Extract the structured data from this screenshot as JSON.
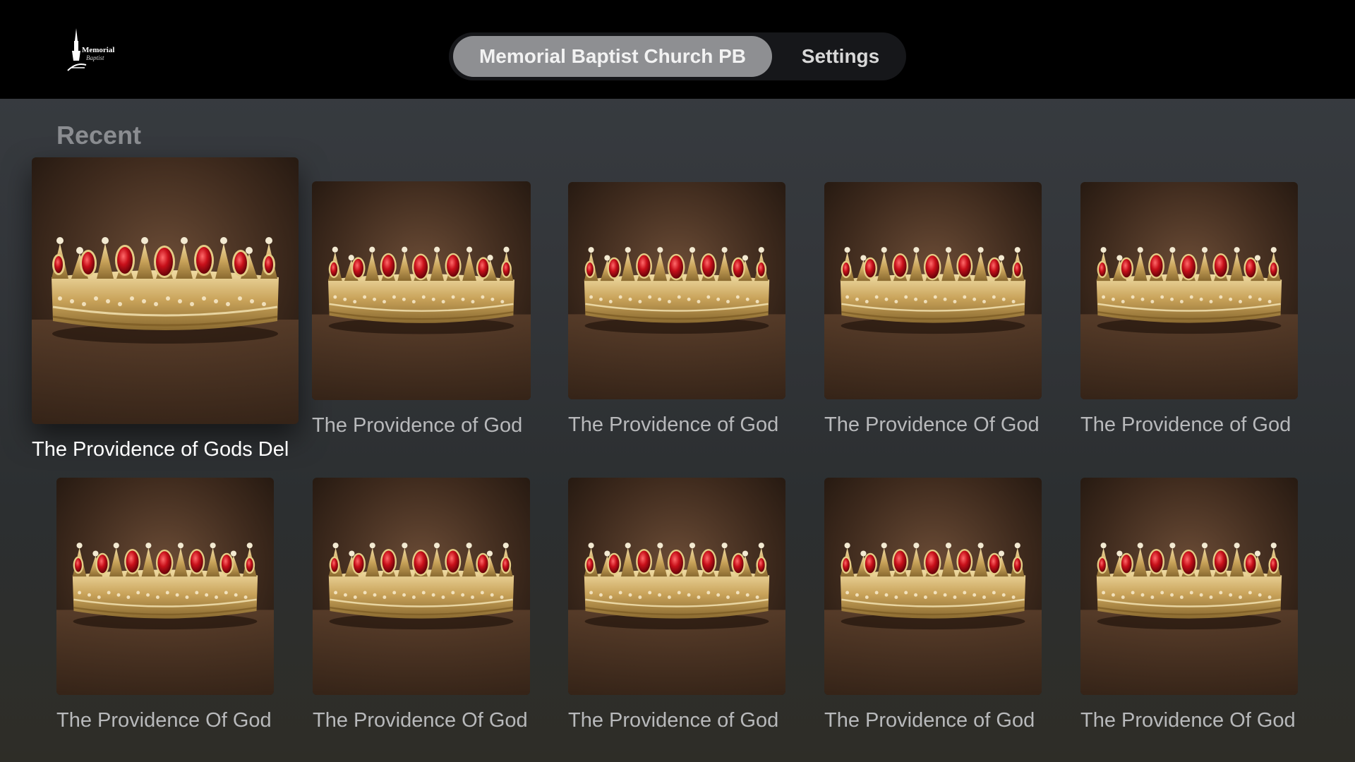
{
  "app": {
    "logo_text": "Memorial",
    "logo_sub": "Baptist"
  },
  "nav": {
    "tabs": [
      {
        "label": "Memorial Baptist Church PB",
        "active": true
      },
      {
        "label": "Settings",
        "active": false
      }
    ]
  },
  "section": {
    "title": "Recent"
  },
  "items": [
    {
      "title": "The Providence of Gods Del",
      "thumbnail": "crown-image",
      "focused": true
    },
    {
      "title": "The Providence of God",
      "thumbnail": "crown-image",
      "focused": false
    },
    {
      "title": "The Providence of God",
      "thumbnail": "crown-image",
      "focused": false
    },
    {
      "title": "The Providence Of God",
      "thumbnail": "crown-image",
      "focused": false
    },
    {
      "title": "The Providence of God",
      "thumbnail": "crown-image",
      "focused": false
    },
    {
      "title": "The Providence Of God",
      "thumbnail": "crown-image",
      "focused": false
    },
    {
      "title": "The Providence Of God",
      "thumbnail": "crown-image",
      "focused": false
    },
    {
      "title": "The Providence of God",
      "thumbnail": "crown-image",
      "focused": false
    },
    {
      "title": "The Providence of God",
      "thumbnail": "crown-image",
      "focused": false
    },
    {
      "title": "The Providence Of God",
      "thumbnail": "crown-image",
      "focused": false
    }
  ],
  "colors": {
    "background": "#33363a",
    "topbar": "#000000",
    "active_tab": "#8e8f92",
    "caption": "#b8b9bb",
    "caption_focused": "#ffffff",
    "gem": "#c8101a",
    "gold": "#c9a35a"
  }
}
